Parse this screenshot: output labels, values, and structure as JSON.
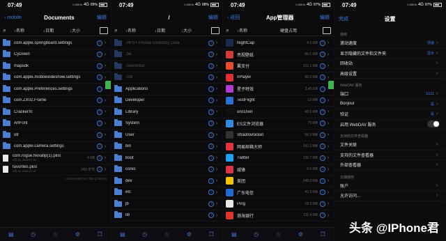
{
  "status": {
    "time": "07:49",
    "speeds": [
      "0.00K/s",
      "0.00K/s",
      "0.00K/s",
      "0.00K/s"
    ],
    "network": "4G",
    "batteries": [
      "89%",
      "88%",
      "87%",
      "87%"
    ]
  },
  "panel1": {
    "back": "mobile",
    "title": "Documents",
    "edit": "编辑",
    "cols": {
      "name": "名称",
      "date": "日期",
      "size": "大小"
    },
    "rows": [
      {
        "name": "com.apple.springboard.settings",
        "type": "folder"
      },
      {
        "name": "CyDown",
        "type": "folder"
      },
      {
        "name": "mapsdk",
        "type": "folder"
      },
      {
        "name": "com.apple.mobileslideshow.settings",
        "type": "folder"
      },
      {
        "name": "com.apple.Preferences.settings",
        "type": "folder"
      },
      {
        "name": "com.ZX02.Frame",
        "type": "folder"
      },
      {
        "name": "CrackerXI",
        "type": "folder"
      },
      {
        "name": "ArtFont",
        "type": "folder"
      },
      {
        "name": "otr",
        "type": "folder"
      },
      {
        "name": "com.apple.camera.settings",
        "type": "folder"
      },
      {
        "name": "com.rogue.hexafip(1).plist",
        "type": "file",
        "sub": "2月 16, 2020 07:20",
        "size": "4 KB"
      },
      {
        "name": "favorites.plist",
        "type": "file",
        "sub": "2月 16, 2020 07:37",
        "size": "243 字节"
      }
    ],
    "footer": "/documents/   8.2 GB   (2 items)"
  },
  "panel2": {
    "title": "/",
    "edit": "编辑",
    "cols": {
      "name": "名称",
      "date": "日期",
      "size": "大小"
    },
    "rows": [
      {
        "name": ".HFS+ Private Directory Data",
        "dim": true
      },
      {
        "name": ".ba",
        "dim": true
      },
      {
        "name": ".fseventsd",
        "dim": true
      },
      {
        "name": ".mb",
        "dim": true
      },
      {
        "name": "Applications",
        "dim": false
      },
      {
        "name": "Developer",
        "dim": false
      },
      {
        "name": "Library",
        "dim": false
      },
      {
        "name": "System",
        "dim": false
      },
      {
        "name": "User",
        "dim": false
      },
      {
        "name": "bin",
        "dim": false
      },
      {
        "name": "boot",
        "dim": false
      },
      {
        "name": "cores",
        "dim": false
      },
      {
        "name": "dev",
        "dim": false
      },
      {
        "name": "etc",
        "dim": false
      },
      {
        "name": "jb",
        "dim": false
      },
      {
        "name": "lib",
        "dim": false
      }
    ]
  },
  "panel3": {
    "back": "返回",
    "title": "App管理器",
    "edit": "编辑",
    "cols": {
      "name": "名称",
      "usage": "硬盘占用"
    },
    "rows": [
      {
        "name": "NightCap",
        "size": "4.5 MB",
        "color": "#1c2a4a"
      },
      {
        "name": "亮视壁纸",
        "size": "66.1 MB",
        "color": "#d33a3a"
      },
      {
        "name": "翼支付",
        "size": "101.1 MB",
        "color": "#e64b2b"
      },
      {
        "name": "nPlayer",
        "size": "90.3 MB",
        "color": "#e03030"
      },
      {
        "name": "星子特效",
        "size": "2.45 GB",
        "color": "#b23ad1"
      },
      {
        "name": "TestFlight",
        "size": "13 MB",
        "color": "#2c6fd8"
      },
      {
        "name": "uncOver",
        "size": "48.9 MB",
        "color": "#111111"
      },
      {
        "name": "ES文件浏览器",
        "size": "75 MB",
        "color": "#2f8be0"
      },
      {
        "name": "Shadowrocket",
        "size": "58.3 MB",
        "color": "#333333"
      },
      {
        "name": "网易邮箱大师",
        "size": "241.2 MB",
        "color": "#e6323e"
      },
      {
        "name": "Twitter",
        "size": "120.7 MB",
        "color": "#1da1f2"
      },
      {
        "name": "威锋",
        "size": "9.5 MB",
        "color": "#dd3344"
      },
      {
        "name": "美团",
        "size": "248.3 MB",
        "color": "#f6c300"
      },
      {
        "name": "广东电信",
        "size": "41.5 MB",
        "color": "#1f6bd1"
      },
      {
        "name": "Ping",
        "size": "19.3 MB",
        "color": "#e8e8e8"
      },
      {
        "name": "渤海银行",
        "size": "111.4 MB",
        "color": "#e0352b"
      }
    ]
  },
  "panel4": {
    "done": "完成",
    "title": "设置",
    "sections": [
      {
        "header": "通用",
        "rows": [
          {
            "label": "滚动速度",
            "value": "快速"
          },
          {
            "label": "显示隐藏的文件和文件夹",
            "value": "显示"
          },
          {
            "label": "回收站",
            "value": ""
          },
          {
            "label": "高级设置",
            "value": ""
          }
        ]
      },
      {
        "header": "WebDAV 服务",
        "rows": [
          {
            "label": "端口",
            "value": "11111"
          },
          {
            "label": "Bonjour",
            "value": "是"
          },
          {
            "label": "验证",
            "value": "是"
          },
          {
            "label": "启用 WebDAV 服务",
            "value": "",
            "toggle": true
          }
        ]
      },
      {
        "header": "支持的文件查看器",
        "rows": [
          {
            "label": "文件关联",
            "value": ""
          },
          {
            "label": "支持的文件查看器",
            "value": ""
          },
          {
            "label": "外部查看器",
            "value": ""
          }
        ]
      },
      {
        "header": "云端储存",
        "rows": [
          {
            "label": "账户",
            "value": ""
          },
          {
            "label": "允许访问...",
            "value": ""
          }
        ]
      }
    ]
  },
  "watermark": "头条 @IPhone君",
  "colors": {
    "accent": "#3d7bd9",
    "folder": "#4b7fd1",
    "background": "#0b0b0d"
  }
}
